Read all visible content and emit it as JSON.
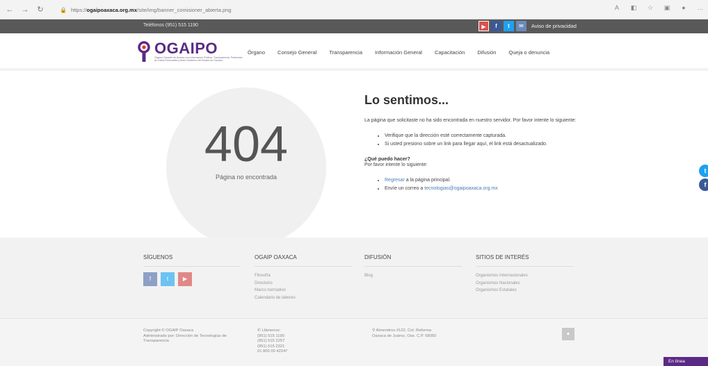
{
  "browser": {
    "url_prefix": "https://",
    "url_host": "ogaipoaxaca.org.mx",
    "url_path": "/site/img/banner_comisioner_abierta.png"
  },
  "top_bar": {
    "phone": "Teléfonos (951) 515 1190",
    "social": [
      "youtube-icon",
      "facebook-icon",
      "twitter-icon",
      "mail-icon"
    ],
    "privacy": "Aviso de privacidad"
  },
  "header": {
    "logo_title": "OGAIPO",
    "logo_subtitle": "Órgano Garante de Acceso a la Información Pública, Transparencia, Protección de Datos Personales y Buen Gobierno del Estado de Oaxaca",
    "nav": [
      "Órgano",
      "Consejo General",
      "Transparencia",
      "Información General",
      "Capacitación",
      "Difusión",
      "Queja o denuncia"
    ]
  },
  "error": {
    "code": "404",
    "label": "Página no encontrada",
    "title": "Lo sentimos...",
    "intro": "La página que solicitaste no ha sido encontrada en nuestro servidor. Por favor intente lo siguiente:",
    "checks": [
      "Verifique que la dirección esté correctamente capturada.",
      "Si usted presiono sobre un link para llegar aquí, el link está desactualizado."
    ],
    "what_title": "¿Qué puedo hacer?",
    "what_intro": "Por favor intente lo siguiente:",
    "back_link": "Regresar",
    "back_rest": " a la página principal.",
    "email_prefix": "Envíe un correo a ",
    "email": "tecnologias@ogaipoaxaca.org.mx"
  },
  "footer": {
    "follow_title": "SÍGUENOS",
    "ogaip_title": "OGAIP OAXACA",
    "ogaip_links": [
      "Filosofía",
      "Directorio",
      "Marco normativo",
      "Calendario de labores"
    ],
    "difusion_title": "DIFUSIÓN",
    "difusion_links": [
      "Blog"
    ],
    "sites_title": "SITIOS DE INTERÉS",
    "sites_links": [
      "Organismos Internacionales",
      "Organismos Nacionales",
      "Organismos Estatales"
    ],
    "copyright": [
      "Copyright © OGAIP Oaxaca",
      "Administrado por: Dirección de Tecnologías de",
      "Transparencia"
    ],
    "phones_title": "Llámenos:",
    "phones": [
      "(951) 515 1190",
      "(951) 515 2257",
      "(951) 515 2321",
      "01 800 00 42247"
    ],
    "address": [
      "Almendros #122, Col. Reforma",
      "Oaxaca de Juárez, Oax. C.P. 68050"
    ],
    "chat": "En línea"
  },
  "colors": {
    "brand": "#5b2a86",
    "top_bar": "#595959",
    "link": "#4a7ab4"
  }
}
